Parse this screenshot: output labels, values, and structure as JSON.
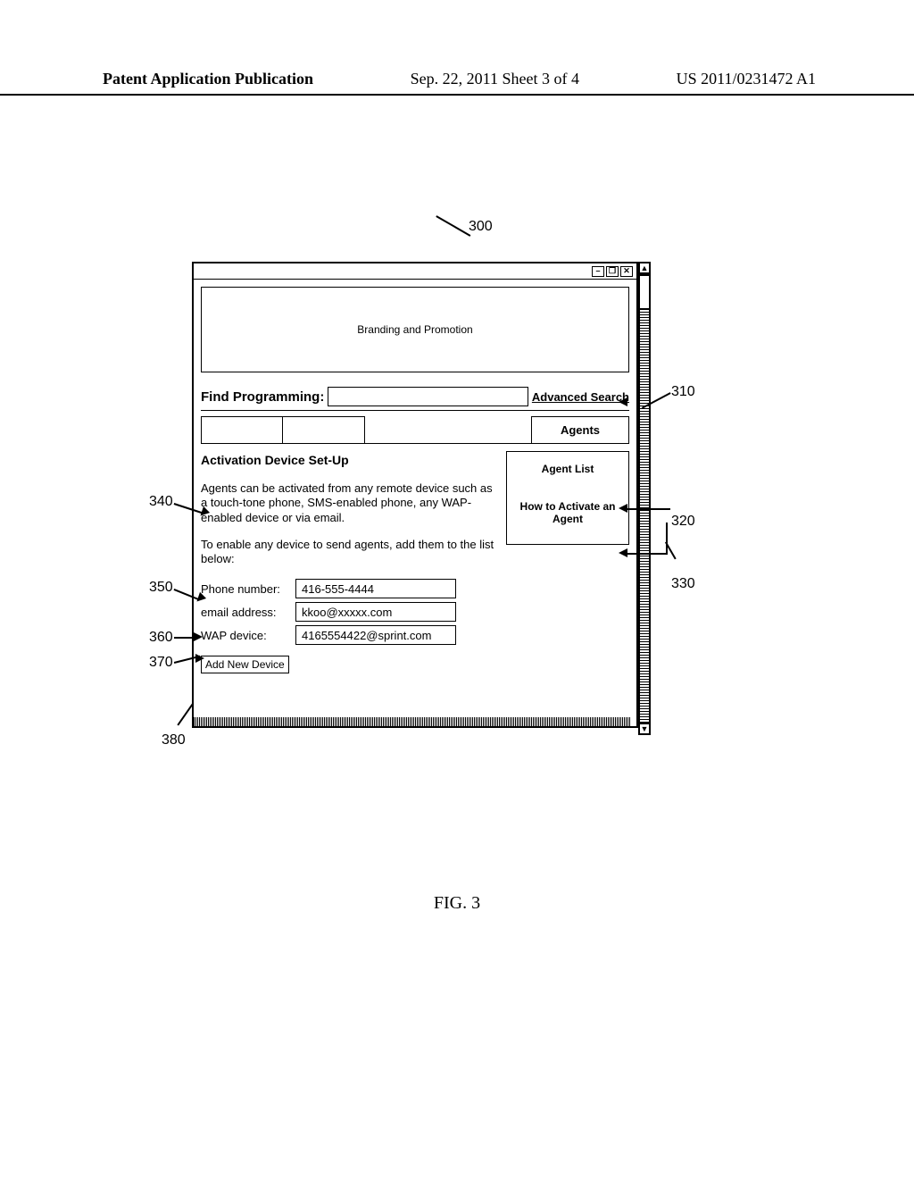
{
  "header": {
    "left": "Patent Application Publication",
    "mid": "Sep. 22, 2011  Sheet 3 of 4",
    "right": "US 2011/0231472 A1"
  },
  "figure": {
    "ref_main": "300",
    "caption": "FIG. 3"
  },
  "callouts": {
    "c310": "310",
    "c320": "320",
    "c330": "330",
    "c340": "340",
    "c350": "350",
    "c360": "360",
    "c370": "370",
    "c380": "380"
  },
  "window": {
    "controls": {
      "min": "–",
      "max": "❐",
      "close": "✕"
    },
    "branding": "Branding and Promotion",
    "search_label": "Find Programming:",
    "advanced_link": "Advanced Search",
    "tab_agents": "Agents",
    "section_title": "Activation Device Set-Up",
    "para1": "Agents can be activated from any remote device such as a touch-tone phone, SMS-enabled phone, any WAP-enabled device or via email.",
    "para2": "To enable any device to send agents, add them to the list below:",
    "fields": {
      "phone_label": "Phone number:",
      "phone_value": "416-555-4444",
      "email_label": "email address:",
      "email_value": "kkoo@xxxxx.com",
      "wap_label": "WAP  device:",
      "wap_value": "4165554422@sprint.com"
    },
    "add_button": "Add New Device",
    "sidebox": {
      "item1": "Agent List",
      "item2": "How to Activate an Agent"
    }
  }
}
